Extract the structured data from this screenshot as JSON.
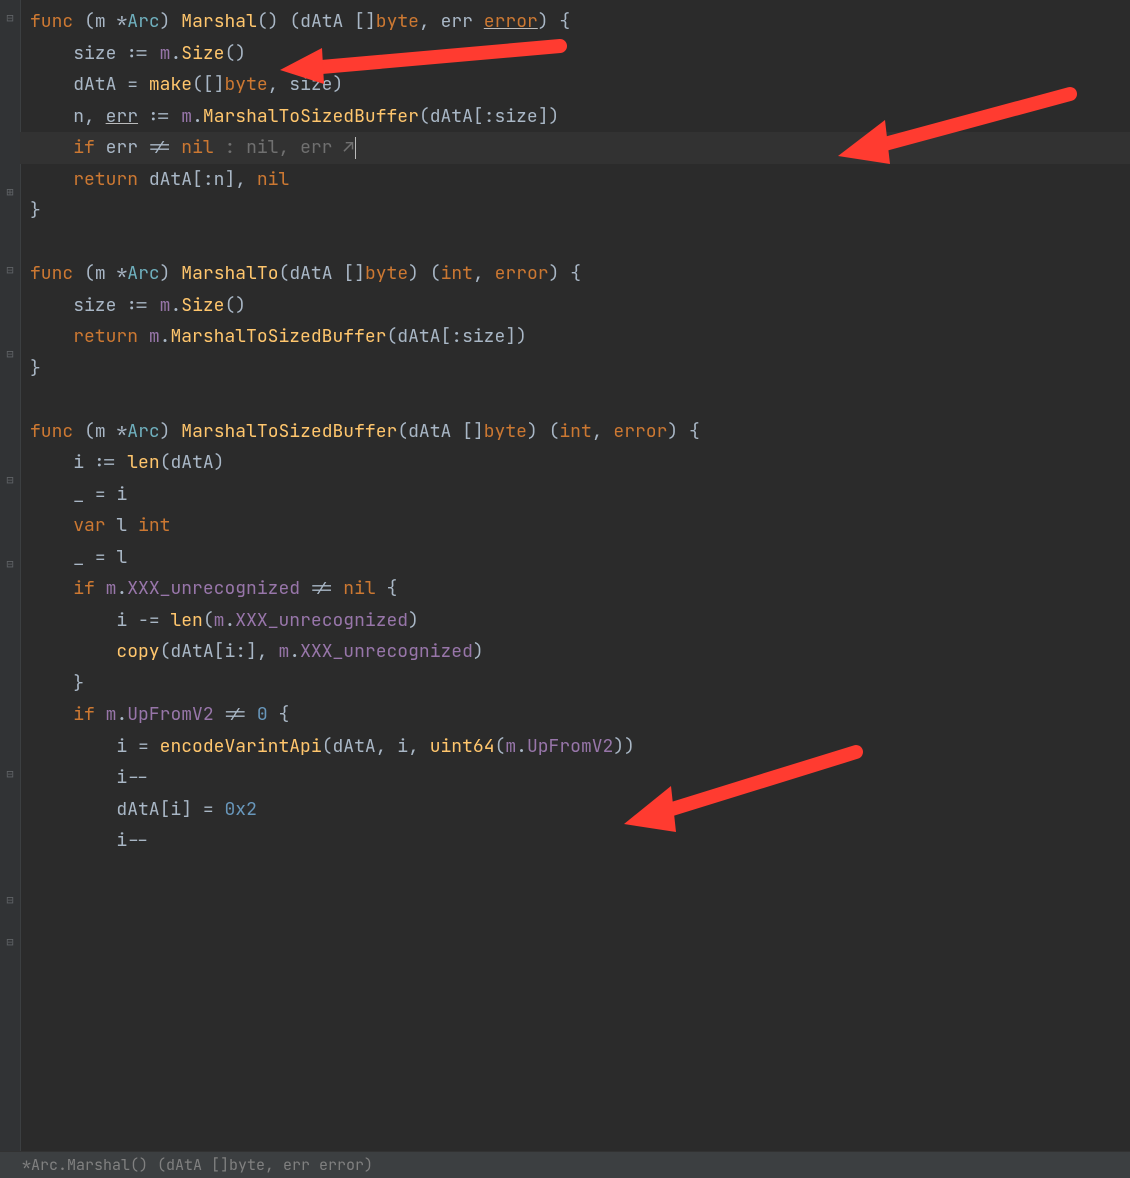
{
  "code": {
    "l1": {
      "func": "func",
      "recv_open": "(",
      "recv_m": "m",
      "recv_star": "*",
      "recv_type": "Arc",
      "recv_close": ")",
      "name": "Marshal",
      "params": "()",
      "ret_open": "(",
      "ret_p1": "dAtA",
      "ret_t1": "[]",
      "ret_t1b": "byte",
      "sep": ", ",
      "ret_p2": "err",
      "ret_t2": "error",
      "ret_close": ")",
      "brace": "{"
    },
    "l2": {
      "ind": "    ",
      "lhs": "size",
      "op": ":=",
      "recv": "m",
      "dot": ".",
      "call": "Size",
      "paren": "()"
    },
    "l3": {
      "ind": "    ",
      "lhs": "dAtA",
      "op": "=",
      "mk": "make",
      "open": "(",
      "t": "[]",
      "tb": "byte",
      "sep": ", ",
      "arg": "size",
      "close": ")"
    },
    "l4": {
      "ind": "    ",
      "lhs1": "n",
      "sep": ", ",
      "lhs2": "err",
      "op": ":=",
      "recv": "m",
      "dot": ".",
      "call": "MarshalToSizedBuffer",
      "open": "(",
      "arg": "dAtA",
      "slice_open": "[:",
      "slice_arg": "size",
      "slice_close": "])"
    },
    "l5": {
      "ind": "    ",
      "kw": "if",
      "cond_l": "err",
      "op": "!=",
      "cond_r": "nil",
      "folded": " : nil, err ↗"
    },
    "l6": {
      "ind": "    ",
      "kw": "return",
      "v1": "dAtA",
      "slice": "[:",
      "n": "n",
      "slice_end": "]",
      "sep": ", ",
      "v2": "nil"
    },
    "l7": {
      "brace": "}"
    },
    "l8": {
      "blank": ""
    },
    "l9": {
      "func": "func",
      "recv_open": "(",
      "recv_m": "m",
      "recv_star": "*",
      "recv_type": "Arc",
      "recv_close": ")",
      "name": "MarshalTo",
      "open": "(",
      "p1": "dAtA",
      "t1": "[]",
      "t1b": "byte",
      "close": ")",
      "ret_open": "(",
      "rt1": "int",
      "sep": ", ",
      "rt2": "error",
      "ret_close": ")",
      "brace": "{"
    },
    "l10": {
      "ind": "    ",
      "lhs": "size",
      "op": ":=",
      "recv": "m",
      "dot": ".",
      "call": "Size",
      "paren": "()"
    },
    "l11": {
      "ind": "    ",
      "kw": "return",
      "recv": "m",
      "dot": ".",
      "call": "MarshalToSizedBuffer",
      "open": "(",
      "arg": "dAtA",
      "slice": "[:",
      "sarg": "size",
      "close": "])"
    },
    "l12": {
      "brace": "}"
    },
    "l13": {
      "blank": ""
    },
    "l14": {
      "func": "func",
      "recv_open": "(",
      "recv_m": "m",
      "recv_star": "*",
      "recv_type": "Arc",
      "recv_close": ")",
      "name": "MarshalToSizedBuffer",
      "open": "(",
      "p1": "dAtA",
      "t1": "[]",
      "t1b": "byte",
      "close": ")",
      "ret_open": "(",
      "rt1": "int",
      "sep": ", ",
      "rt2": "error",
      "ret_close": ")",
      "brace": "{"
    },
    "l15": {
      "ind": "    ",
      "lhs": "i",
      "op": ":=",
      "fn": "len",
      "open": "(",
      "arg": "dAtA",
      "close": ")"
    },
    "l16": {
      "ind": "    ",
      "lhs": "_",
      "op": "=",
      "rhs": "i"
    },
    "l17": {
      "ind": "    ",
      "kw": "var",
      "name": "l",
      "type": "int"
    },
    "l18": {
      "ind": "    ",
      "lhs": "_",
      "op": "=",
      "rhs": "l"
    },
    "l19": {
      "ind": "    ",
      "kw": "if",
      "recv": "m",
      "dot": ".",
      "field": "XXX_unrecognized",
      "op": "!=",
      "rhs": "nil",
      "brace": "{"
    },
    "l20": {
      "ind": "        ",
      "lhs": "i",
      "op": "-=",
      "fn": "len",
      "open": "(",
      "recv": "m",
      "dot": ".",
      "field": "XXX_unrecognized",
      "close": ")"
    },
    "l21": {
      "ind": "        ",
      "fn": "copy",
      "open": "(",
      "arg1": "dAtA",
      "slice": "[",
      "sarg": "i",
      "send": ":]",
      "sep": ", ",
      "recv": "m",
      "dot": ".",
      "field": "XXX_unrecognized",
      "close": ")"
    },
    "l22": {
      "ind": "    ",
      "brace": "}"
    },
    "l23": {
      "ind": "    ",
      "kw": "if",
      "recv": "m",
      "dot": ".",
      "field": "UpFromV2",
      "op": "!=",
      "rhs": "0",
      "brace": "{"
    },
    "l24": {
      "ind": "        ",
      "lhs": "i",
      "op": "=",
      "fn": "encodeVarintApi",
      "open": "(",
      "a1": "dAtA",
      "s1": ", ",
      "a2": "i",
      "s2": ", ",
      "cast": "uint64",
      "copen": "(",
      "recv": "m",
      "dot": ".",
      "field": "UpFromV2",
      "cclose": "))"
    },
    "l25": {
      "ind": "        ",
      "stmt": "i--"
    },
    "l26": {
      "ind": "        ",
      "lhs": "dAtA",
      "idx_open": "[",
      "idx": "i",
      "idx_close": "]",
      "op": "=",
      "val": "0x2"
    },
    "l27": {
      "ind": "        ",
      "stmt": "i--"
    }
  },
  "breadcrumb": "*Arc.Marshal() (dAtA []byte, err error)",
  "fold_icons": {
    "minus": "⊟",
    "plus": "⊞",
    "end": "⊟"
  }
}
